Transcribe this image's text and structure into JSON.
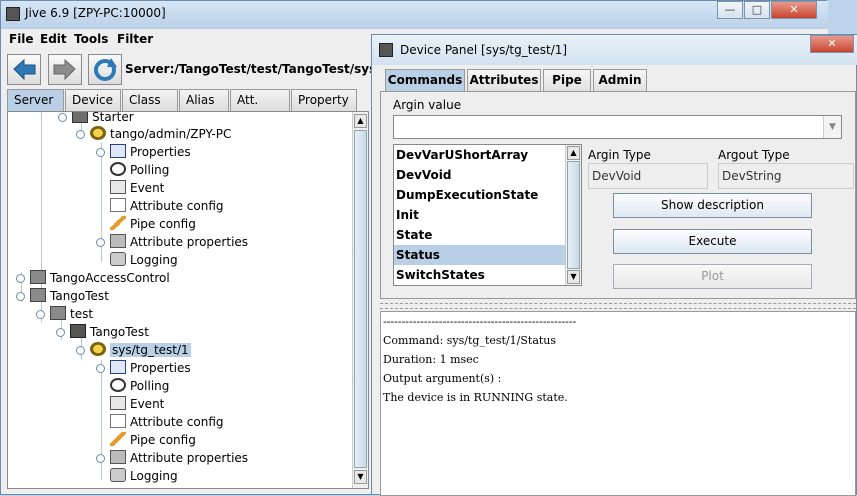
{
  "jive": {
    "title": "Jive 6.9  [ZPY-PC:10000]",
    "menu": [
      "File",
      "Edit",
      "Tools",
      "Filter"
    ],
    "server_path": "Server:/TangoTest/test/TangoTest/sys/tg_te",
    "tabs": [
      "Server",
      "Device",
      "Class",
      "Alias",
      "Att. Alias",
      "Property"
    ],
    "active_tab": "Server"
  },
  "tree": {
    "starter": "Starter",
    "admin": "tango/admin/ZPY-PC",
    "admin_children": [
      "Properties",
      "Polling",
      "Event",
      "Attribute config",
      "Pipe config",
      "Attribute properties",
      "Logging"
    ],
    "access_control": "TangoAccessControl",
    "tangotest": "TangoTest",
    "test": "test",
    "tangotest_class": "TangoTest",
    "device": "sys/tg_test/1",
    "device_children": [
      "Properties",
      "Polling",
      "Event",
      "Attribute config",
      "Pipe config",
      "Attribute properties",
      "Logging"
    ]
  },
  "device_panel": {
    "title": "Device Panel [sys/tg_test/1]",
    "tabs": [
      "Commands",
      "Attributes",
      "Pipe",
      "Admin"
    ],
    "argin_label": "Argin value",
    "argin_value": "",
    "commands": [
      "DevVarUShortArray",
      "DevVoid",
      "DumpExecutionState",
      "Init",
      "State",
      "Status",
      "SwitchStates"
    ],
    "selected_command": "Status",
    "argin_type_label": "Argin Type",
    "argin_type": "DevVoid",
    "argout_type_label": "Argout Type",
    "argout_type": "DevString",
    "show_description": "Show description",
    "execute": "Execute",
    "plot": "Plot",
    "output": {
      "separator": "----------------------------------------------------",
      "command": "Command: sys/tg_test/1/Status",
      "duration": "Duration: 1 msec",
      "output_arg": "Output argument(s) :",
      "result": "The device is in RUNNING state."
    }
  },
  "colors": {
    "selection": "#b8cfe5",
    "title_bar": "#c9dcef"
  }
}
